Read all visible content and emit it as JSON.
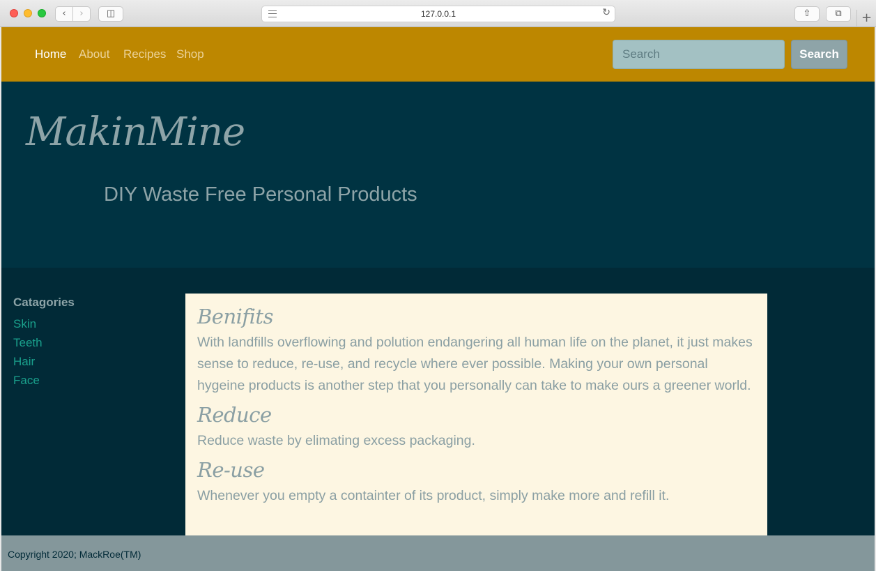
{
  "browser": {
    "url": "127.0.0.1",
    "icons": [
      "back-icon",
      "forward-icon",
      "sidebar-icon",
      "reader-icon",
      "reload-icon",
      "share-icon",
      "tabs-icon",
      "new-tab-icon"
    ]
  },
  "nav": {
    "links": [
      "Home",
      "About",
      "Recipes",
      "Shop"
    ],
    "search_placeholder": "Search",
    "search_button": "Search"
  },
  "hero": {
    "brand": "MakinMine",
    "tagline": "DIY Waste Free Personal Products"
  },
  "sidebar": {
    "heading": "Catagories",
    "items": [
      "Skin",
      "Teeth",
      "Hair",
      "Face"
    ]
  },
  "content": {
    "sections": [
      {
        "heading": "Benifits",
        "text": "With landfills overflowing and polution endangering all human life on the planet, it just makes sense to reduce, re-use, and recycle where ever possible. Making your own personal hygeine products is another step that you personally can take to make ours a greener world."
      },
      {
        "heading": "Reduce",
        "text": "Reduce waste by elimating excess packaging."
      },
      {
        "heading": "Re-use",
        "text": "Whenever you empty a containter of its product, simply make more and refill it."
      }
    ]
  },
  "footer": {
    "text": "Copyright 2020; MackRoe(TM)"
  },
  "colors": {
    "nav_bg": "#bd8700",
    "hero_bg": "#003342",
    "page_bg": "#012a37",
    "card_bg": "#fdf6e2",
    "link": "#1aa08c",
    "footer_bg": "#84979b"
  }
}
